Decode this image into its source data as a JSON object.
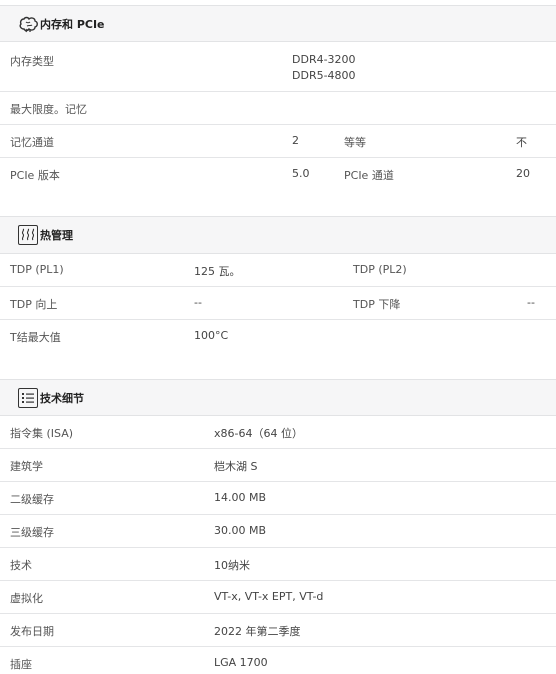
{
  "memory": {
    "title": "内存和 PCIe",
    "icon": "brain-icon",
    "rows": [
      {
        "label": "内存类型",
        "values": [
          "DDR4-3200",
          "DDR5-4800"
        ]
      },
      {
        "label": "最大限度。记忆"
      },
      {
        "label": "记忆通道",
        "value": "2",
        "label2": "等等",
        "value2": "不"
      },
      {
        "label": "PCIe 版本",
        "value": "5.0",
        "label2": "PCIe 通道",
        "value2": "20"
      }
    ]
  },
  "thermal": {
    "title": "热管理",
    "icon": "heat-waves-icon",
    "rows": [
      {
        "label": "TDP (PL1)",
        "value": "125 瓦。",
        "label2": "TDP (PL2)",
        "value2": ""
      },
      {
        "label": "TDP 向上",
        "value": "--",
        "label2": "TDP 下降",
        "value2": "--"
      },
      {
        "label": "T结最大值",
        "value": "100°C"
      }
    ]
  },
  "tech": {
    "title": "技术细节",
    "icon": "list-icon",
    "rows": [
      {
        "label": "指令集 (ISA)",
        "value": "x86-64（64 位）"
      },
      {
        "label": "建筑学",
        "value": "桤木湖 S"
      },
      {
        "label": "二级缓存",
        "value": "14.00 MB"
      },
      {
        "label": "三级缓存",
        "value": "30.00 MB"
      },
      {
        "label": "技术",
        "value": "10纳米"
      },
      {
        "label": "虚拟化",
        "value": "VT-x, VT-x EPT, VT-d"
      },
      {
        "label": "发布日期",
        "value": "2022 年第二季度"
      },
      {
        "label": "插座",
        "value": "LGA 1700"
      }
    ]
  }
}
